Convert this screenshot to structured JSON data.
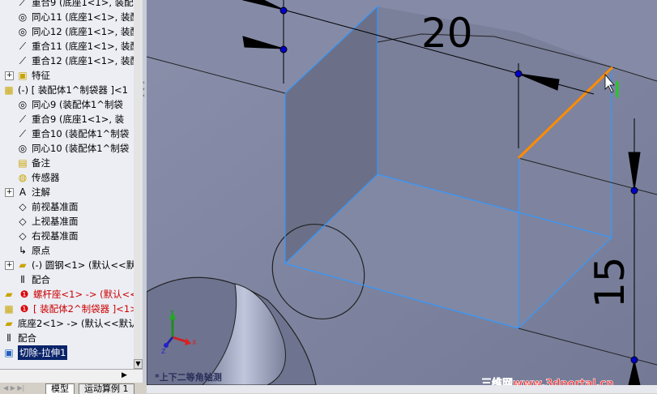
{
  "tree": [
    {
      "label": "重合9  (底座1<1>, 装配",
      "icon": "coincident-icon",
      "indent": 20
    },
    {
      "label": "同心11  (底座1<1>, 装配",
      "icon": "concentric-icon",
      "indent": 20
    },
    {
      "label": "同心12  (底座1<1>, 装配",
      "icon": "concentric-icon",
      "indent": 20
    },
    {
      "label": "重合11  (底座1<1>, 装配",
      "icon": "coincident-icon",
      "indent": 20
    },
    {
      "label": "重合12  (底座1<1>, 装配",
      "icon": "coincident-icon",
      "indent": 20
    },
    {
      "label": "特征",
      "icon": "features-folder-icon",
      "indent": 20,
      "expand": true
    },
    {
      "label": "(-)  [ 装配体1^制袋器 ]<1",
      "icon": "subassembly-icon",
      "indent": 3
    },
    {
      "label": "同心9  (装配体1^制袋",
      "icon": "concentric-fixed-icon",
      "indent": 20
    },
    {
      "label": "重合9  (底座1<1>, 装",
      "icon": "coincident-fixed-icon",
      "indent": 20
    },
    {
      "label": "重合10  (装配体1^制袋",
      "icon": "coincident-icon",
      "indent": 20
    },
    {
      "label": "同心10  (装配体1^制袋",
      "icon": "concentric-icon",
      "indent": 20
    },
    {
      "label": "备注",
      "icon": "notes-folder-icon",
      "indent": 20
    },
    {
      "label": "传感器",
      "icon": "sensor-folder-icon",
      "indent": 20
    },
    {
      "label": "注解",
      "icon": "annotations-icon",
      "indent": 20,
      "expand": true
    },
    {
      "label": "前视基准面",
      "icon": "plane-icon",
      "indent": 20
    },
    {
      "label": "上视基准面",
      "icon": "plane-icon",
      "indent": 20
    },
    {
      "label": "右视基准面",
      "icon": "plane-icon",
      "indent": 20
    },
    {
      "label": "原点",
      "icon": "origin-icon",
      "indent": 20
    },
    {
      "label": "(-)  圆钢<1>  (默认<<默",
      "icon": "part-icon",
      "indent": 20,
      "expand": true
    },
    {
      "label": "配合",
      "icon": "mates-icon",
      "indent": 20
    },
    {
      "label": "螺杆座<1> ->  (默认<<默",
      "icon": "part-warning-icon",
      "indent": 3,
      "red": true
    },
    {
      "label": "[ 装配体2^制袋器 ]<1>",
      "icon": "subassembly-warning-icon",
      "indent": 3,
      "red": true
    },
    {
      "label": "底座2<1> ->  (默认<<默认",
      "icon": "part-icon",
      "indent": 3
    },
    {
      "label": "配合",
      "icon": "mates-icon",
      "indent": 3
    },
    {
      "label": "切除-拉伸1",
      "icon": "cut-extrude-icon",
      "indent": 3,
      "selected": true
    }
  ],
  "tabs": {
    "model": "模型",
    "motion": "运动算例 1"
  },
  "view": {
    "dim_20": "20",
    "dim_15": "15",
    "view_name": "*上下二等角轴测",
    "watermark": "三维网www.3dportal.cn",
    "axis_x": "X",
    "axis_y": "Y",
    "axis_z": "Z"
  },
  "colors": {
    "selected_edge": "#ff8c00",
    "model_edge": "#3399ff",
    "dimension_point": "#0000cc"
  }
}
